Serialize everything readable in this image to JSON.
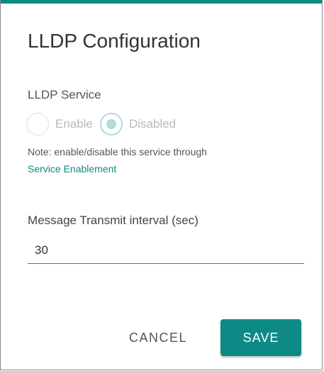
{
  "dialog": {
    "title": "LLDP Configuration"
  },
  "lldp_service": {
    "label": "LLDP Service",
    "options": [
      {
        "label": "Enable",
        "selected": false,
        "disabled": true
      },
      {
        "label": "Disabled",
        "selected": true,
        "disabled": true
      }
    ],
    "note": "Note: enable/disable this service through",
    "note_link": "Service Enablement"
  },
  "transmit_interval": {
    "label": "Message Transmit interval (sec)",
    "value": "30"
  },
  "actions": {
    "cancel_label": "CANCEL",
    "save_label": "SAVE"
  },
  "colors": {
    "accent": "#0e8a86",
    "disabled_radio": "#b3dcd9"
  }
}
